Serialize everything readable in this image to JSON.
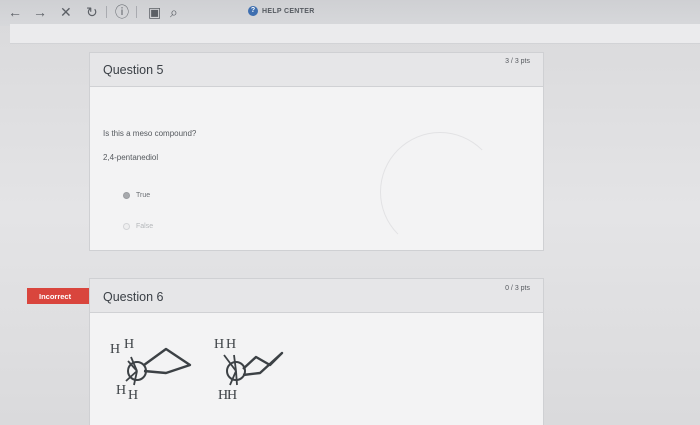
{
  "browser": {
    "nav_icons": [
      "←",
      "→",
      "✕",
      "↻",
      "ⓘ",
      "▣",
      "⌕"
    ],
    "help_center": "HELP CENTER"
  },
  "question5": {
    "title": "Question 5",
    "points": "3 / 3 pts",
    "prompt": "Is this a meso compound?",
    "compound": "2,4-pentanediol",
    "options": [
      {
        "label": "True",
        "selected": true
      },
      {
        "label": "False",
        "selected": false
      }
    ]
  },
  "question6": {
    "status_badge": "Incorrect",
    "title": "Question 6",
    "points": "0 / 3 pts",
    "molecules": [
      {
        "top_left": "H",
        "top_right": "H",
        "bottom_left": "H",
        "bottom_right": "H"
      },
      {
        "top_left": "H",
        "top_right": "H",
        "bottom_left": "H",
        "bottom_right": "H"
      }
    ]
  },
  "colors": {
    "incorrect": "#d9453d",
    "help_icon": "#3e6fb0"
  }
}
